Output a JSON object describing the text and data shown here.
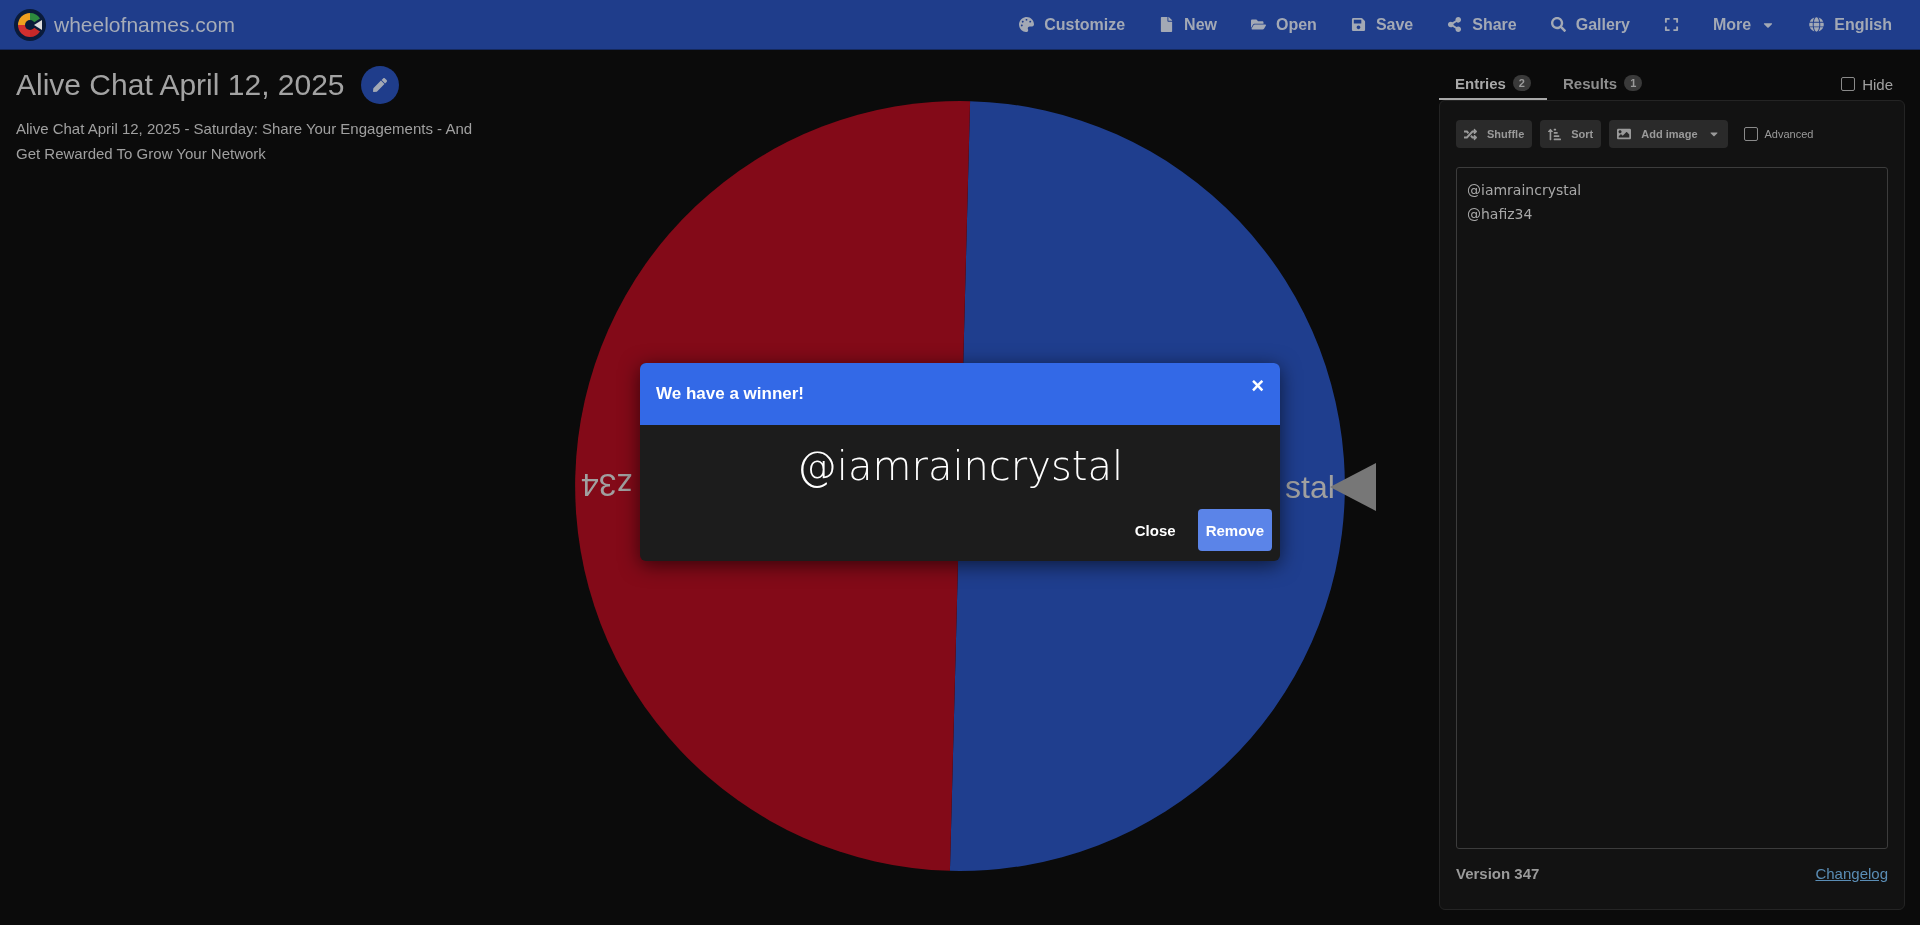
{
  "header": {
    "site": "wheelofnames.com",
    "menu": [
      {
        "kind": "text",
        "label": "Customize",
        "dropdown": false
      },
      {
        "kind": "text",
        "label": "New",
        "dropdown": false
      },
      {
        "kind": "text",
        "label": "Open",
        "dropdown": false
      },
      {
        "kind": "text",
        "label": "Save",
        "dropdown": false
      },
      {
        "kind": "text",
        "label": "Share",
        "dropdown": false
      },
      {
        "kind": "text",
        "label": "Gallery",
        "dropdown": false
      },
      {
        "kind": "icon"
      },
      {
        "kind": "text",
        "label": "More",
        "dropdown": true
      },
      {
        "kind": "text",
        "label": "English",
        "dropdown": false
      }
    ]
  },
  "wheel": {
    "title": "Alive Chat April 12, 2025",
    "description": "Alive Chat April 12, 2025 - Saturday: Share Your Engagements - And Get Rewarded To Grow Your Network",
    "slices": [
      {
        "label": "stal",
        "color": "#1f3e8e"
      },
      {
        "label": "z34",
        "color": "#830a18"
      }
    ]
  },
  "dialog": {
    "title": "We have a winner!",
    "close_icon": "×",
    "winner": "@iamraincrystal",
    "buttons": [
      {
        "label": "Close",
        "kind": "plain"
      },
      {
        "label": "Remove",
        "kind": "primary"
      }
    ]
  },
  "panel": {
    "tabs": [
      {
        "label": "Entries",
        "count": "2",
        "selected": true
      },
      {
        "label": "Results",
        "count": "1",
        "selected": false
      }
    ],
    "hide": {
      "label": "Hide",
      "checked": false
    },
    "toolbar": [
      {
        "kind": "button",
        "label": "Shuffle"
      },
      {
        "kind": "button",
        "label": "Sort"
      },
      {
        "kind": "dropdown",
        "label": "Add image"
      },
      {
        "kind": "checkbox",
        "label": "Advanced",
        "checked": false
      }
    ],
    "entries": [
      "@iamraincrystal",
      "@hafiz34"
    ],
    "version": "Version 347",
    "changelog": "Changelog"
  }
}
